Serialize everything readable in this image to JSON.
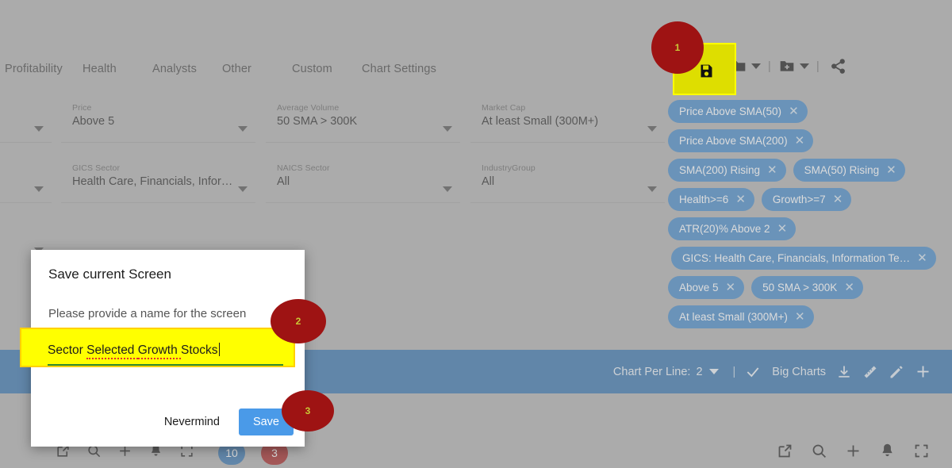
{
  "theme": {
    "page_bg": "#ababab",
    "chip_blue": "#3b82c4",
    "action_bar_blue": "#2c6ca8",
    "highlight_yellow": "#ffff00",
    "save_button_blue": "#4a9ae8",
    "badge_red": "#9e1313"
  },
  "tabs": [
    {
      "label": "Profitability"
    },
    {
      "label": "Health"
    },
    {
      "label": "Analysts"
    },
    {
      "label": "Other"
    },
    {
      "label": "Custom"
    },
    {
      "label": "Chart Settings"
    }
  ],
  "filters": [
    {
      "label": "Price",
      "value": "Above 5"
    },
    {
      "label": "Average Volume",
      "value": "50 SMA > 300K"
    },
    {
      "label": "Market Cap",
      "value": "At least Small (300M+)"
    },
    {
      "label": "GICS Sector",
      "value": "Health Care, Financials, Infor…"
    },
    {
      "label": "NAICS Sector",
      "value": "All"
    },
    {
      "label": "IndustryGroup",
      "value": "All"
    }
  ],
  "chips": [
    {
      "label": "Price Above SMA(50)",
      "remove": "✕"
    },
    {
      "label": "Price Above SMA(200)",
      "remove": "✕"
    },
    {
      "label": "SMA(200) Rising",
      "remove": "✕"
    },
    {
      "label": "SMA(50) Rising",
      "remove": "✕"
    },
    {
      "label": "Health>=6",
      "remove": "✕"
    },
    {
      "label": "Growth>=7",
      "remove": "✕"
    },
    {
      "label": "ATR(20)% Above 2",
      "remove": "✕"
    },
    {
      "label": "GICS: Health Care, Financials, Information Te…",
      "remove": "✕"
    },
    {
      "label": "Above 5",
      "remove": "✕"
    },
    {
      "label": "50 SMA > 300K",
      "remove": "✕"
    },
    {
      "label": "At least Small (300M+)",
      "remove": "✕"
    }
  ],
  "toolbar": {
    "save_icon": "floppy-disk-icon",
    "open_folder_icon": "folder-icon",
    "new_folder_icon": "folder-plus-icon",
    "share_icon": "share-icon",
    "divider": "|"
  },
  "action_bar": {
    "chart_per_line_label": "Chart Per Line:",
    "chart_per_line_value": "2",
    "divider": "|",
    "check_icon": "check-icon",
    "big_charts_label": "Big Charts",
    "download_icon": "download-icon",
    "ruler_icon": "ruler-icon",
    "pencil_icon": "pencil-icon",
    "plus_icon": "plus-icon"
  },
  "bottom_bar": {
    "left_icons": [
      "external-link-icon",
      "search-icon",
      "plus-icon",
      "bell-icon",
      "fullscreen-icon"
    ],
    "counters": [
      {
        "value": "10",
        "color": "blue"
      },
      {
        "value": "3",
        "color": "red"
      }
    ],
    "right_icons": [
      "external-link-icon",
      "search-icon",
      "plus-icon",
      "bell-icon",
      "fullscreen-icon"
    ]
  },
  "dialog": {
    "title": "Save current Screen",
    "prompt": "Please provide a name for the screen",
    "name_value": "Sector Selected Growth Stocks",
    "name_placeholder": "",
    "name_misspelled_words": [
      "Selected",
      "Growth"
    ],
    "cancel_label": "Nevermind",
    "save_label": "Save"
  },
  "annotations": [
    {
      "number": "1",
      "target": "save-toolbar-button"
    },
    {
      "number": "2",
      "target": "screen-name-input"
    },
    {
      "number": "3",
      "target": "dialog-save-button"
    }
  ]
}
